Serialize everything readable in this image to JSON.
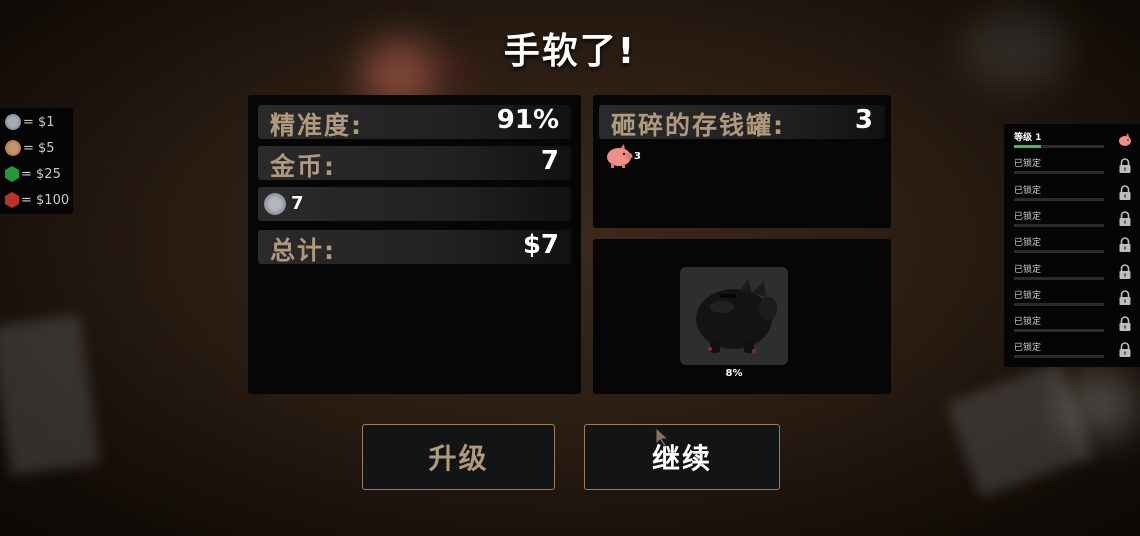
{
  "title": "手软了!",
  "stats": {
    "accuracy_label": "精准度:",
    "accuracy_value": "91%",
    "coins_label": "金币:",
    "coins_value": "7",
    "silver_count": "7",
    "total_label": "总计:",
    "total_value": "$7"
  },
  "smashed": {
    "label": "砸碎的存钱罐:",
    "value": "3",
    "pig_count": "3"
  },
  "next_bank": {
    "progress_text": "8%",
    "progress": 0.08
  },
  "buttons": {
    "upgrade": "升级",
    "continue": "继续"
  },
  "coin_legend": [
    {
      "icon": "silver-coin-icon",
      "color": "#8a8f96",
      "text": "= $1"
    },
    {
      "icon": "bronze-coin-icon",
      "color": "#b07a4c",
      "text": "= $5"
    },
    {
      "icon": "green-gem-icon",
      "color": "#1f9a3a",
      "text": "= $25"
    },
    {
      "icon": "red-gem-icon",
      "color": "#b8342a",
      "text": "= $100"
    }
  ],
  "levels": [
    {
      "label": "等级 1",
      "progress": 0.3,
      "locked": false
    },
    {
      "label": "已锁定",
      "progress": 0,
      "locked": true
    },
    {
      "label": "已锁定",
      "progress": 0,
      "locked": true
    },
    {
      "label": "已锁定",
      "progress": 0,
      "locked": true
    },
    {
      "label": "已锁定",
      "progress": 0,
      "locked": true
    },
    {
      "label": "已锁定",
      "progress": 0,
      "locked": true
    },
    {
      "label": "已锁定",
      "progress": 0,
      "locked": true
    },
    {
      "label": "已锁定",
      "progress": 0,
      "locked": true
    },
    {
      "label": "已锁定",
      "progress": 0,
      "locked": true
    }
  ],
  "colors": {
    "accent_border": "#9a7d5c",
    "label_color": "#b09a7e",
    "level_fill": "#36c15a",
    "pig_pink": "#f08f88"
  }
}
